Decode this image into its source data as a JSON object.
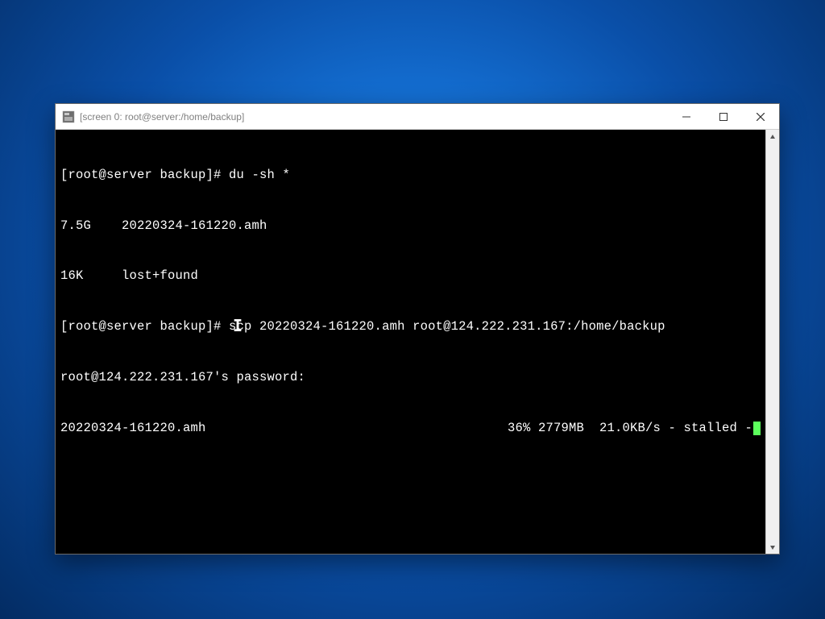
{
  "window": {
    "title": "[screen 0: root@server:/home/backup]"
  },
  "terminal": {
    "lines": {
      "l0": "[root@server backup]# du -sh *",
      "l1": "7.5G    20220324-161220.amh",
      "l2": "16K     lost+found",
      "l3": "[root@server backup]# scp 20220324-161220.amh root@124.222.231.167:/home/backup",
      "l4": "root@124.222.231.167's password:",
      "l5_left": "20220324-161220.amh",
      "l5_right": "36% 2779MB  21.0KB/s - stalled -"
    }
  }
}
